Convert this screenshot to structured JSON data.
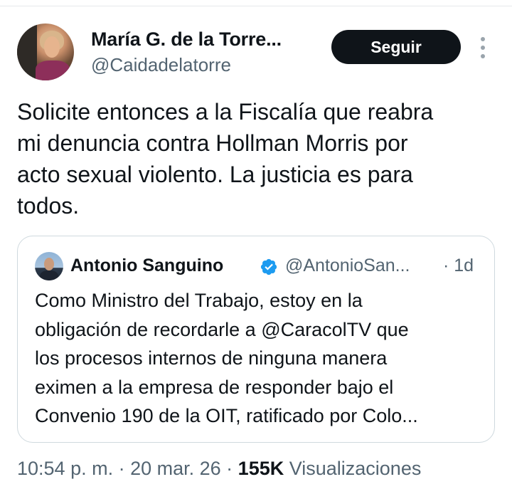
{
  "author": {
    "name": "María G. de la Torre...",
    "handle": "@Caidadelatorre"
  },
  "actions": {
    "follow_label": "Seguir",
    "more_icon": "more-vertical-icon"
  },
  "tweet": {
    "lines": [
      "Solicite entonces a la Fiscalía que reabra",
      "mi denuncia contra Hollman Morris por",
      "acto sexual violento. La justicia es para",
      "todos."
    ]
  },
  "quote": {
    "name": "Antonio Sanguino",
    "verified_icon": "verified-badge-icon",
    "verified_color": "#1d9bf0",
    "handle": "@AntonioSan...",
    "time": "· 1d",
    "lines": [
      "Como Ministro del Trabajo, estoy en la",
      "obligación de recordarle a @CaracolTV que",
      "los procesos internos de ninguna manera",
      "eximen a la empresa de responder bajo el",
      "Convenio 190 de la OIT, ratificado por Colo..."
    ]
  },
  "meta": {
    "time": "10:54 p. m.",
    "separator": " · ",
    "date": "20 mar. 26",
    "views_count": "155K",
    "views_label": " Visualizaciones"
  }
}
